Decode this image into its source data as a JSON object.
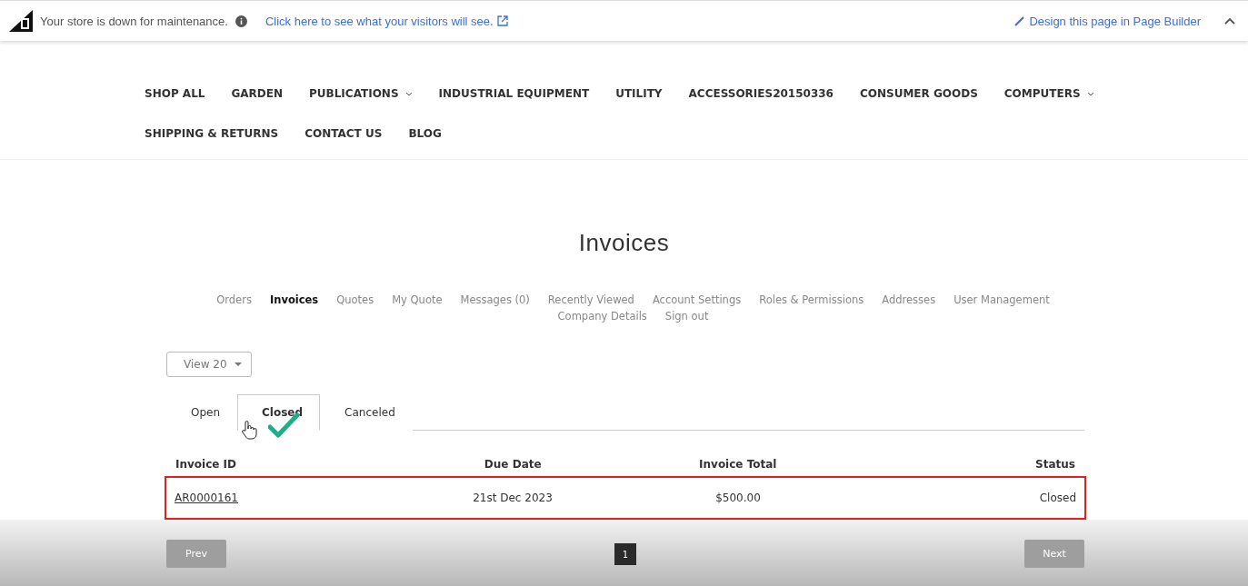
{
  "maintenance_bar": {
    "message": "Your store is down for maintenance.",
    "preview_link": "Click here to see what your visitors will see.",
    "builder_link": "Design this page in Page Builder"
  },
  "nav": [
    {
      "label": "SHOP ALL",
      "dropdown": false
    },
    {
      "label": "GARDEN",
      "dropdown": false
    },
    {
      "label": "PUBLICATIONS",
      "dropdown": true
    },
    {
      "label": "INDUSTRIAL EQUIPMENT",
      "dropdown": false
    },
    {
      "label": "UTILITY",
      "dropdown": false
    },
    {
      "label": "ACCESSORIES20150336",
      "dropdown": false
    },
    {
      "label": "CONSUMER GOODS",
      "dropdown": false
    },
    {
      "label": "COMPUTERS",
      "dropdown": true
    },
    {
      "label": "SHIPPING & RETURNS",
      "dropdown": false
    },
    {
      "label": "CONTACT US",
      "dropdown": false
    },
    {
      "label": "BLOG",
      "dropdown": false
    }
  ],
  "page_title": "Invoices",
  "account_nav": [
    {
      "label": "Orders",
      "selected": false
    },
    {
      "label": "Invoices",
      "selected": true
    },
    {
      "label": "Quotes",
      "selected": false
    },
    {
      "label": "My Quote",
      "selected": false
    },
    {
      "label": "Messages (0)",
      "selected": false
    },
    {
      "label": "Recently Viewed",
      "selected": false
    },
    {
      "label": "Account Settings",
      "selected": false
    },
    {
      "label": "Roles & Permissions",
      "selected": false
    },
    {
      "label": "Addresses",
      "selected": false
    },
    {
      "label": "User Management",
      "selected": false
    },
    {
      "label": "Company Details",
      "selected": false
    },
    {
      "label": "Sign out",
      "selected": false
    }
  ],
  "view_select": {
    "value": "View 20"
  },
  "tabs": [
    {
      "label": "Open",
      "selected": false
    },
    {
      "label": "Closed",
      "selected": true
    },
    {
      "label": "Canceled",
      "selected": false
    }
  ],
  "table": {
    "columns": [
      "Invoice ID",
      "Due Date",
      "Invoice Total",
      "Status"
    ],
    "rows": [
      {
        "invoice_id": "AR0000161",
        "due_date": "21st Dec 2023",
        "invoice_total": "$500.00",
        "status": "Closed",
        "highlighted": true
      }
    ]
  },
  "pagination": {
    "prev": {
      "label": "Prev",
      "disabled": true
    },
    "pages": [
      {
        "label": "1",
        "selected": true
      }
    ],
    "next": {
      "label": "Next",
      "disabled": true
    }
  }
}
